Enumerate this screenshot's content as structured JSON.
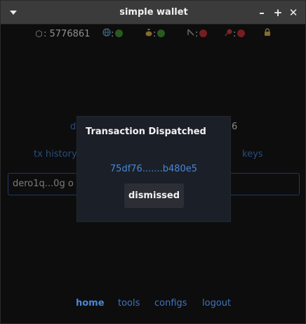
{
  "window": {
    "title": "simple wallet",
    "controls": {
      "minimize": "–",
      "maximize": "+",
      "close": "✕"
    }
  },
  "status": {
    "height_icon": "⬡",
    "height": ": 5776861",
    "network_sep": ":",
    "wallet_sep": ":",
    "node_sep": ":",
    "ws_sep": ":"
  },
  "background": {
    "balance_left": "d",
    "balance_right": "6",
    "tx_history": "tx history",
    "keys": "keys",
    "address_value": "dero1q...0g o"
  },
  "modal": {
    "title": "Transaction Dispatched",
    "txid": "75df76.......b480e5",
    "button": "dismissed"
  },
  "nav": {
    "home": "home",
    "tools": "tools",
    "configs": "configs",
    "logout": "logout"
  },
  "colors": {
    "accent": "#4a86d8",
    "ok": "#3f8a2e",
    "error": "#b22e33"
  },
  "icons": {
    "network": "globe-icon",
    "wallet": "money-bag-icon",
    "node": "node-icon",
    "websocket": "pin-icon",
    "lock": "lock-icon"
  }
}
